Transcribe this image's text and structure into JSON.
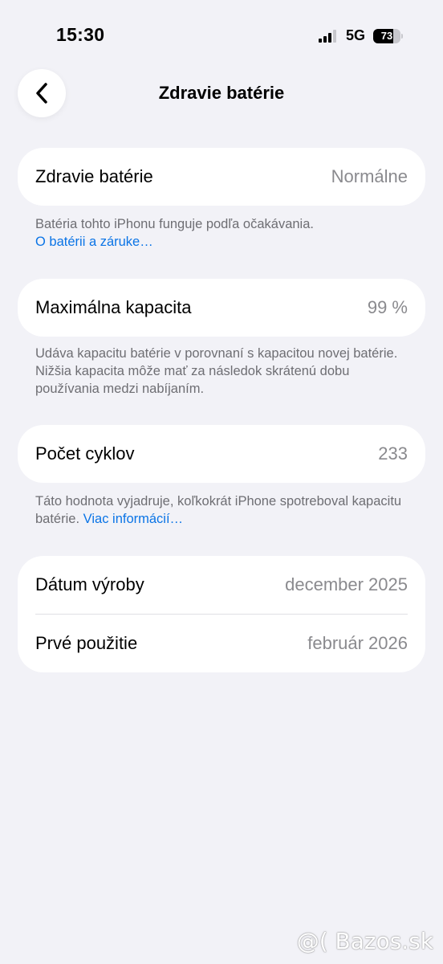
{
  "status_bar": {
    "time": "15:30",
    "network": "5G",
    "battery_percent": "73",
    "battery_level": 0.73,
    "signal_bars_filled": 3,
    "signal_bars_total": 4
  },
  "nav": {
    "back_icon": "chevron-left-icon",
    "title": "Zdravie batérie"
  },
  "battery_health": {
    "label": "Zdravie batérie",
    "value": "Normálne",
    "note": "Batéria tohto iPhonu funguje podľa očakávania.",
    "link": "O batérii a záruke…"
  },
  "max_capacity": {
    "label": "Maximálna kapacita",
    "value": "99 %",
    "note": "Udáva kapacitu batérie v porovnaní s kapacitou novej batérie. Nižšia kapacita môže mať za následok skrátenú dobu používania medzi nabíjaním."
  },
  "cycle_count": {
    "label": "Počet cyklov",
    "value": "233",
    "note": "Táto hodnota vyjadruje, koľkokrát iPhone spotreboval kapacitu batérie.",
    "link": "Viac informácií…"
  },
  "dates": {
    "manufacture_label": "Dátum výroby",
    "manufacture_value": "december 2025",
    "first_use_label": "Prvé použitie",
    "first_use_value": "február 2026"
  },
  "watermark": "@( Bazos.sk"
}
